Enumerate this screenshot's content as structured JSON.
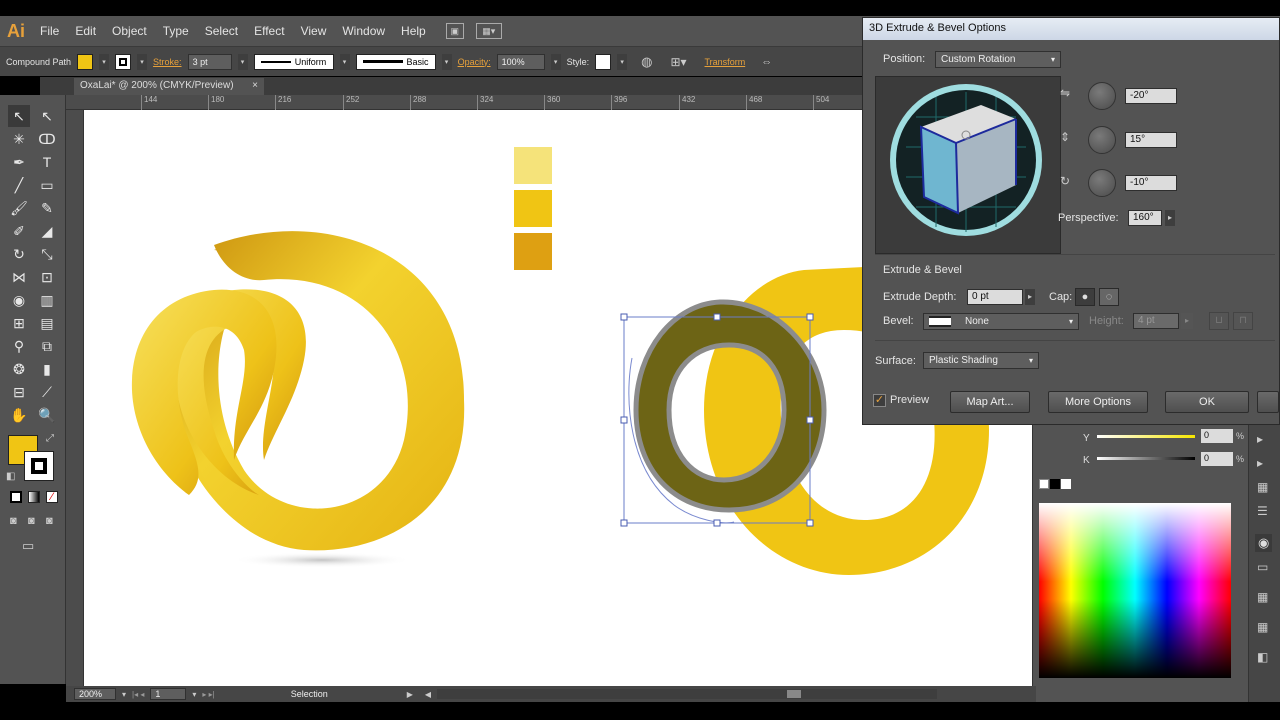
{
  "app": {
    "logo": "Ai",
    "menu": [
      "File",
      "Edit",
      "Object",
      "Type",
      "Select",
      "Effect",
      "View",
      "Window",
      "Help"
    ]
  },
  "controlbar": {
    "selection_type": "Compound Path",
    "stroke_label": "Stroke:",
    "stroke_weight": "3 pt",
    "stroke_profile": "Uniform",
    "brush": "Basic",
    "opacity_label": "Opacity:",
    "opacity": "100%",
    "style_label": "Style:",
    "transform_label": "Transform",
    "fill_color": "#f0c514"
  },
  "document": {
    "tab": "OxaLai* @ 200% (CMYK/Preview)",
    "tab_close": "×",
    "ruler_ticks": [
      "144",
      "180",
      "216",
      "252",
      "288",
      "324",
      "360",
      "396",
      "432",
      "468",
      "504"
    ]
  },
  "status": {
    "zoom": "200%",
    "page": "1",
    "tool_status": "Selection"
  },
  "dialog": {
    "title": "3D Extrude & Bevel Options",
    "position_label": "Position:",
    "position_value": "Custom Rotation",
    "rot_x": "-20°",
    "rot_y": "15°",
    "rot_z": "-10°",
    "perspective_label": "Perspective:",
    "perspective_value": "160°",
    "extrude_section": "Extrude & Bevel",
    "extrude_depth_label": "Extrude Depth:",
    "extrude_depth_value": "0 pt",
    "cap_label": "Cap:",
    "bevel_label": "Bevel:",
    "bevel_value": "None",
    "height_label": "Height:",
    "height_value": "4 pt",
    "surface_label": "Surface:",
    "surface_value": "Plastic Shading",
    "preview_label": "Preview",
    "preview_checked": true,
    "map_art_button": "Map Art...",
    "more_options_button": "More Options",
    "ok_button": "OK"
  },
  "color_panel": {
    "y_label": "Y",
    "y_value": "0",
    "k_label": "K",
    "k_value": "0",
    "percent": "%"
  },
  "swatches": [
    "#f5e37a",
    "#f0c514",
    "#dea012"
  ],
  "colors": {
    "accent": "#e7a13b",
    "panel": "#535353",
    "gold": "#f0c514",
    "olive": "#6d6415"
  }
}
